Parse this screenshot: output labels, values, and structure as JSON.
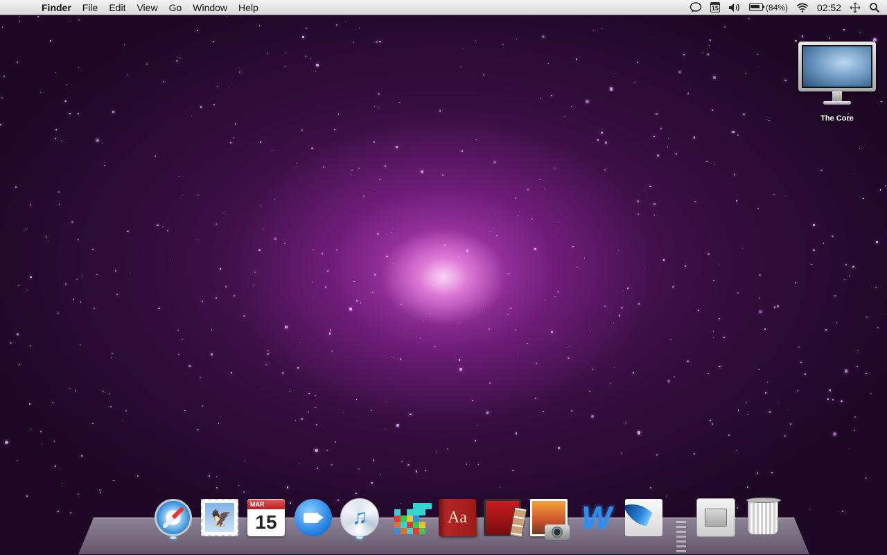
{
  "menubar": {
    "apple_glyph": "",
    "app_name": "Finder",
    "menus": [
      "File",
      "Edit",
      "View",
      "Go",
      "Window",
      "Help"
    ],
    "status": {
      "calendar_day": "15",
      "battery_percent_text": "(84%)",
      "battery_level": 0.84,
      "clock": "02:52"
    }
  },
  "desktop": {
    "icons": [
      {
        "label": "The Core",
        "icon": "display-icon"
      }
    ]
  },
  "dock": {
    "apps": [
      {
        "name": "Safari",
        "icon": "safari-icon"
      },
      {
        "name": "Mail",
        "icon": "mail-stamp-icon"
      },
      {
        "name": "iCal",
        "icon": "calendar-icon",
        "month": "MAR",
        "day": "15"
      },
      {
        "name": "iChat",
        "icon": "ichat-icon"
      },
      {
        "name": "iTunes",
        "icon": "itunes-icon"
      },
      {
        "name": "Blocks",
        "icon": "blocks-icon"
      },
      {
        "name": "Dictionary",
        "icon": "dictionary-icon",
        "glyph": "Aa"
      },
      {
        "name": "Photo Booth",
        "icon": "photobooth-icon"
      },
      {
        "name": "iPhoto",
        "icon": "iphoto-icon"
      },
      {
        "name": "Word",
        "icon": "word-icon",
        "glyph": "W"
      },
      {
        "name": "Photoshop",
        "icon": "photoshop-feather-icon"
      }
    ],
    "right": [
      {
        "name": "Documents",
        "icon": "documents-stack-icon"
      },
      {
        "name": "Trash",
        "icon": "trash-icon"
      }
    ]
  }
}
